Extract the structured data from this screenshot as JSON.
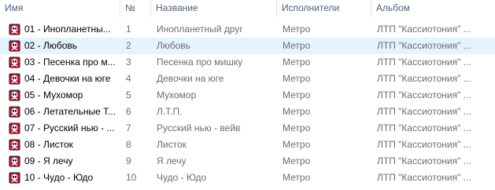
{
  "columns": {
    "name": "Имя",
    "number": "№",
    "title": "Название",
    "artists": "Исполнители",
    "album": "Альбом"
  },
  "sort_indicator": "^",
  "icon": "media-file-icon",
  "colors": {
    "selected_row": "#e5f3ff",
    "header_text": "#4c607a",
    "secondary_text": "#6d6d6d",
    "icon_red": "#c8102e"
  },
  "rows": [
    {
      "name": "01 - Инопланетны...",
      "number": "1",
      "title": "Инопланетный друг",
      "artist": "Метро",
      "album": "ЛТП \"Кассиотония\" ...",
      "selected": false
    },
    {
      "name": "02 - Любовь",
      "number": "2",
      "title": "Любовь",
      "artist": "Метро",
      "album": "ЛТП \"Кассиотония\" ...",
      "selected": true
    },
    {
      "name": "03 - Песенка про м...",
      "number": "3",
      "title": "Песенка про мишку",
      "artist": "Метро",
      "album": "ЛТП \"Кассиотония\" ...",
      "selected": false
    },
    {
      "name": "04 - Девочки на юге",
      "number": "4",
      "title": "Девочки на юге",
      "artist": "Метро",
      "album": "ЛТП \"Кассиотония\" ...",
      "selected": false
    },
    {
      "name": "05 - Мухомор",
      "number": "5",
      "title": "Мухомор",
      "artist": "Метро",
      "album": "ЛТП \"Кассиотония\" ...",
      "selected": false
    },
    {
      "name": "06 - Летательные Т...",
      "number": "6",
      "title": "Л.Т.П.",
      "artist": "Метро",
      "album": "ЛТП \"Кассиотония\" ...",
      "selected": false
    },
    {
      "name": "07 - Русский нью - ...",
      "number": "7",
      "title": "Русский нью - вейв",
      "artist": "Метро",
      "album": "ЛТП \"Кассиотония\" ...",
      "selected": false
    },
    {
      "name": "08 - Листок",
      "number": "8",
      "title": "Листок",
      "artist": "Метро",
      "album": "ЛТП \"Кассиотония\" ...",
      "selected": false
    },
    {
      "name": "09 - Я лечу",
      "number": "9",
      "title": "Я лечу",
      "artist": "Метро",
      "album": "ЛТП \"Кассиотония\" ...",
      "selected": false
    },
    {
      "name": "10 - Чудо - Юдо",
      "number": "10",
      "title": "Чудо - Юдо",
      "artist": "Метро",
      "album": "ЛТП \"Кассиотония\" ...",
      "selected": false
    }
  ]
}
